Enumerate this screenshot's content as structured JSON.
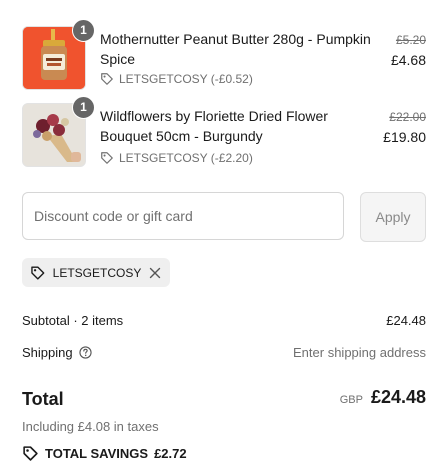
{
  "line_items": [
    {
      "quantity": "1",
      "name": "Mothernutter Peanut Butter 280g - Pumpkin Spice",
      "discount": "LETSGETCOSY (-£0.52)",
      "original_price": "£5.20",
      "price": "£4.68"
    },
    {
      "quantity": "1",
      "name": "Wildflowers by Floriette Dried Flower Bouquet 50cm - Burgundy",
      "discount": "LETSGETCOSY (-£2.20)",
      "original_price": "£22.00",
      "price": "£19.80"
    }
  ],
  "discount_form": {
    "placeholder": "Discount code or gift card",
    "apply_label": "Apply"
  },
  "applied_code": "LETSGETCOSY",
  "summary": {
    "subtotal_label": "Subtotal · 2 items",
    "subtotal_value": "£24.48",
    "shipping_label": "Shipping",
    "shipping_value": "Enter shipping address",
    "total_label": "Total",
    "currency": "GBP",
    "total_value": "£24.48",
    "taxes_note": "Including £4.08 in taxes",
    "savings_label": "TOTAL SAVINGS",
    "savings_value": "£2.72"
  },
  "colors": {
    "text": "#1a1a1a",
    "muted": "#707070",
    "qty_badge": "#666666",
    "thumb1_bg": "#f0532e"
  },
  "icons": {
    "discount_tag": "tag-icon",
    "remove": "close-icon",
    "info": "question-circle-icon",
    "savings": "tag-icon"
  }
}
